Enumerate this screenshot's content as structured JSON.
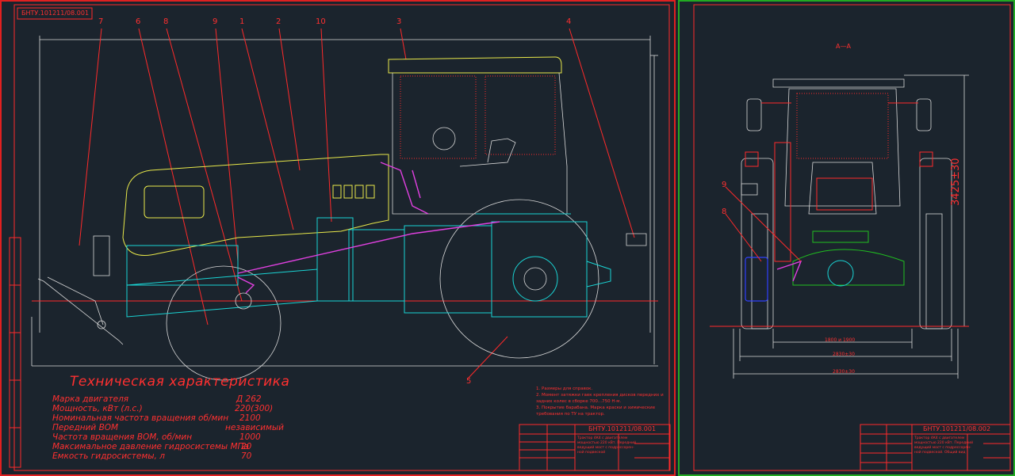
{
  "sheet_left": {
    "corner_stamp": "БНТУ.101211/08.001",
    "callouts": [
      "7",
      "6",
      "8",
      "9",
      "1",
      "2",
      "10",
      "3",
      "4",
      "5"
    ],
    "spec": {
      "title": "Техническая характеристика",
      "rows": [
        {
          "label": "Марка двигателя",
          "value": "Д 262"
        },
        {
          "label": "Мощность, кВт (л.с.)",
          "value": "220(300)"
        },
        {
          "label": "Номинальная частота вращения об/мин",
          "value": "2100"
        },
        {
          "label": "Передний ВОМ",
          "value": "независимый"
        },
        {
          "label": "Частота вращения ВОМ, об/мин",
          "value": "1000"
        },
        {
          "label": "Максимальное давление гидросистемы МПа",
          "value": "20"
        },
        {
          "label": "Емкость гидросистемы, л",
          "value": "70"
        }
      ]
    },
    "notes": [
      "1. Размеры для справок.",
      "2. Момент затяжки гаек крепления дисков передних и",
      "задних колес в сборке 700...750 Н·м.",
      "3. Покрытие барабана. Марка краски и химические",
      "требования по ТУ на трактор."
    ],
    "title_block_code": "БНТУ.101211/08.001",
    "title_block_desc": [
      "Трактор 4К4 с двигателем",
      "мощностью 220 кВт. Передний",
      "ведущий мост с подрессорен-",
      "ной подвеской"
    ]
  },
  "sheet_right": {
    "section_label": "А—А",
    "callouts": [
      "9",
      "8"
    ],
    "dim_height": "3425±30",
    "dim_track": "1800 и 1900",
    "dim_width_1": "2830±30",
    "dim_width_2": "2830±30",
    "title_block_code": "БНТУ.101211/08.002",
    "title_block_desc": [
      "Трактор 4К4 с двигателем",
      "мощностью 220 кВт. Передний",
      "ведущий мост с подрессорен-",
      "ной подвеской. Общий вид"
    ]
  },
  "colors": {
    "outline": "#ff2a2a",
    "frame_right": "#22aa22",
    "chassis": "#1ad5d5",
    "body": "#e8e84a",
    "hydraulics": "#e040e0"
  }
}
